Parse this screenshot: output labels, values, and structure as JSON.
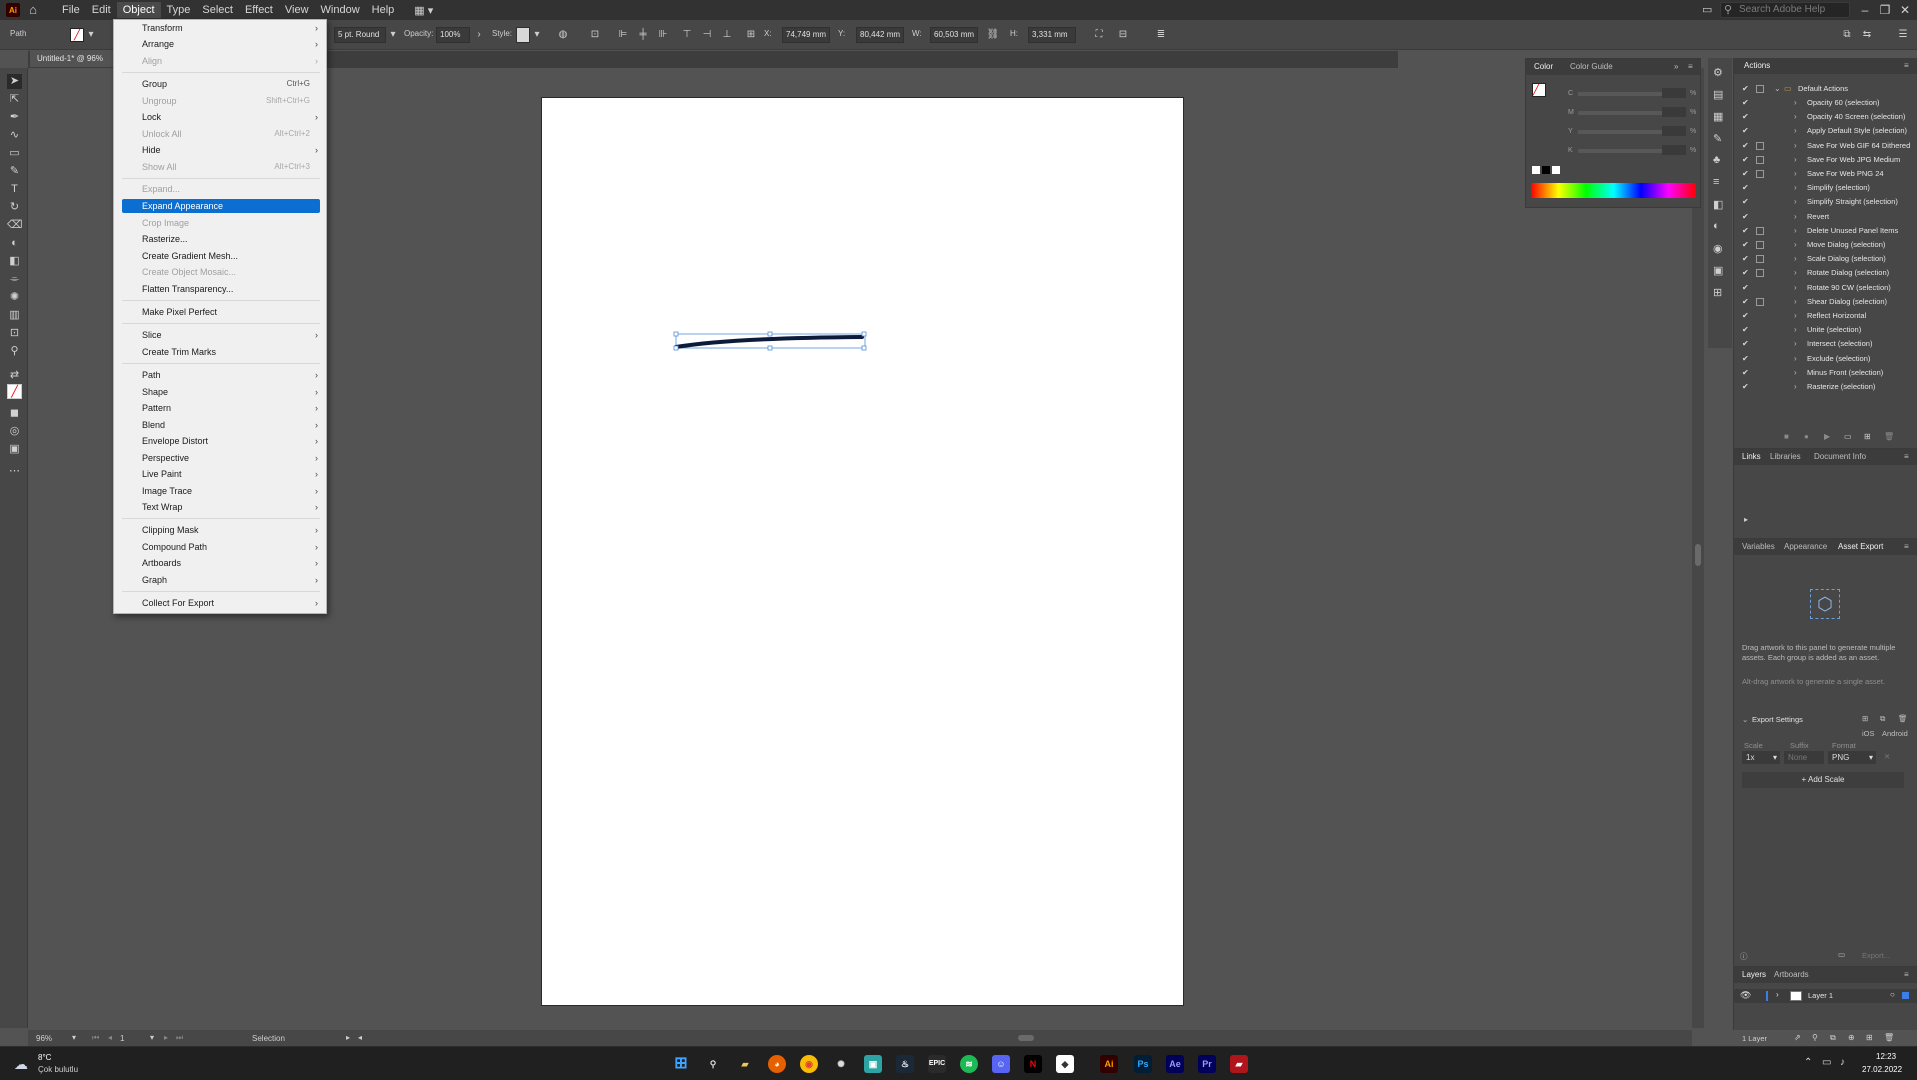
{
  "menubar": {
    "items": [
      "File",
      "Edit",
      "Object",
      "Type",
      "Select",
      "Effect",
      "View",
      "Window",
      "Help"
    ],
    "active": "Object",
    "app_logo": "Ai",
    "search_placeholder": "Search Adobe Help"
  },
  "control_bar": {
    "selection_type": "Path",
    "stroke_profile": "5 pt. Round",
    "opacity_label": "Opacity:",
    "opacity_value": "100%",
    "style_label": "Style:",
    "x_label": "X:",
    "x_value": "74,749 mm",
    "y_label": "Y:",
    "y_value": "80,442 mm",
    "w_label": "W:",
    "w_value": "60,503 mm",
    "h_label": "H:",
    "h_value": "3,331 mm"
  },
  "document": {
    "tab_title": "Untitled-1* @ 96%"
  },
  "object_menu": {
    "items": [
      {
        "label": "Transform",
        "shortcut": "",
        "submenu": true,
        "disabled": false,
        "selected": false
      },
      {
        "label": "Arrange",
        "shortcut": "",
        "submenu": true,
        "disabled": false,
        "selected": false
      },
      {
        "label": "Align",
        "shortcut": "",
        "submenu": true,
        "disabled": true,
        "selected": false
      },
      {
        "label": "Group",
        "shortcut": "Ctrl+G",
        "submenu": false,
        "disabled": false,
        "selected": false
      },
      {
        "label": "Ungroup",
        "shortcut": "Shift+Ctrl+G",
        "submenu": false,
        "disabled": true,
        "selected": false
      },
      {
        "label": "Lock",
        "shortcut": "",
        "submenu": true,
        "disabled": false,
        "selected": false
      },
      {
        "label": "Unlock All",
        "shortcut": "Alt+Ctrl+2",
        "submenu": false,
        "disabled": true,
        "selected": false
      },
      {
        "label": "Hide",
        "shortcut": "",
        "submenu": true,
        "disabled": false,
        "selected": false
      },
      {
        "label": "Show All",
        "shortcut": "Alt+Ctrl+3",
        "submenu": false,
        "disabled": true,
        "selected": false
      },
      {
        "label": "Expand...",
        "shortcut": "",
        "submenu": false,
        "disabled": true,
        "selected": false
      },
      {
        "label": "Expand Appearance",
        "shortcut": "",
        "submenu": false,
        "disabled": false,
        "selected": true
      },
      {
        "label": "Crop Image",
        "shortcut": "",
        "submenu": false,
        "disabled": true,
        "selected": false
      },
      {
        "label": "Rasterize...",
        "shortcut": "",
        "submenu": false,
        "disabled": false,
        "selected": false
      },
      {
        "label": "Create Gradient Mesh...",
        "shortcut": "",
        "submenu": false,
        "disabled": false,
        "selected": false
      },
      {
        "label": "Create Object Mosaic...",
        "shortcut": "",
        "submenu": false,
        "disabled": true,
        "selected": false
      },
      {
        "label": "Flatten Transparency...",
        "shortcut": "",
        "submenu": false,
        "disabled": false,
        "selected": false
      },
      {
        "label": "Make Pixel Perfect",
        "shortcut": "",
        "submenu": false,
        "disabled": false,
        "selected": false
      },
      {
        "label": "Slice",
        "shortcut": "",
        "submenu": true,
        "disabled": false,
        "selected": false
      },
      {
        "label": "Create Trim Marks",
        "shortcut": "",
        "submenu": false,
        "disabled": false,
        "selected": false
      },
      {
        "label": "Path",
        "shortcut": "",
        "submenu": true,
        "disabled": false,
        "selected": false
      },
      {
        "label": "Shape",
        "shortcut": "",
        "submenu": true,
        "disabled": false,
        "selected": false
      },
      {
        "label": "Pattern",
        "shortcut": "",
        "submenu": true,
        "disabled": false,
        "selected": false
      },
      {
        "label": "Blend",
        "shortcut": "",
        "submenu": true,
        "disabled": false,
        "selected": false
      },
      {
        "label": "Envelope Distort",
        "shortcut": "",
        "submenu": true,
        "disabled": false,
        "selected": false
      },
      {
        "label": "Perspective",
        "shortcut": "",
        "submenu": true,
        "disabled": false,
        "selected": false
      },
      {
        "label": "Live Paint",
        "shortcut": "",
        "submenu": true,
        "disabled": false,
        "selected": false
      },
      {
        "label": "Image Trace",
        "shortcut": "",
        "submenu": true,
        "disabled": false,
        "selected": false
      },
      {
        "label": "Text Wrap",
        "shortcut": "",
        "submenu": true,
        "disabled": false,
        "selected": false
      },
      {
        "label": "Clipping Mask",
        "shortcut": "",
        "submenu": true,
        "disabled": false,
        "selected": false
      },
      {
        "label": "Compound Path",
        "shortcut": "",
        "submenu": true,
        "disabled": false,
        "selected": false
      },
      {
        "label": "Artboards",
        "shortcut": "",
        "submenu": true,
        "disabled": false,
        "selected": false
      },
      {
        "label": "Graph",
        "shortcut": "",
        "submenu": true,
        "disabled": false,
        "selected": false
      },
      {
        "label": "Collect For Export",
        "shortcut": "",
        "submenu": true,
        "disabled": false,
        "selected": false
      }
    ]
  },
  "color_panel": {
    "tabs": [
      "Color",
      "Color Guide"
    ],
    "channels": [
      "C",
      "M",
      "Y",
      "K"
    ],
    "unit": "%"
  },
  "actions_panel": {
    "tab": "Actions",
    "set_name": "Default Actions",
    "actions": [
      {
        "label": "Opacity 60 (selection)",
        "dialog": false
      },
      {
        "label": "Opacity 40 Screen (selection)",
        "dialog": false
      },
      {
        "label": "Apply Default Style (selection)",
        "dialog": false
      },
      {
        "label": "Save For Web GIF 64 Dithered",
        "dialog": true
      },
      {
        "label": "Save For Web JPG Medium",
        "dialog": true
      },
      {
        "label": "Save For Web PNG 24",
        "dialog": true
      },
      {
        "label": "Simplify (selection)",
        "dialog": false
      },
      {
        "label": "Simplify Straight (selection)",
        "dialog": false
      },
      {
        "label": "Revert",
        "dialog": false
      },
      {
        "label": "Delete Unused Panel Items",
        "dialog": true
      },
      {
        "label": "Move Dialog (selection)",
        "dialog": true
      },
      {
        "label": "Scale Dialog (selection)",
        "dialog": true
      },
      {
        "label": "Rotate Dialog (selection)",
        "dialog": true
      },
      {
        "label": "Rotate 90 CW (selection)",
        "dialog": false
      },
      {
        "label": "Shear Dialog (selection)",
        "dialog": true
      },
      {
        "label": "Reflect Horizontal",
        "dialog": false
      },
      {
        "label": "Unite (selection)",
        "dialog": false
      },
      {
        "label": "Intersect (selection)",
        "dialog": false
      },
      {
        "label": "Exclude (selection)",
        "dialog": false
      },
      {
        "label": "Minus Front (selection)",
        "dialog": false
      },
      {
        "label": "Rasterize (selection)",
        "dialog": false
      }
    ]
  },
  "links_panel": {
    "tabs": [
      "Links",
      "Libraries",
      "Document Info"
    ]
  },
  "asset_export_panel": {
    "tabs": [
      "Variables",
      "Appearance",
      "Asset Export"
    ],
    "hint_1": "Drag artwork to this panel to generate multiple assets. Each group is added as an asset.",
    "hint_2": "Alt-drag artwork to generate a single asset.",
    "export_settings_label": "Export Settings",
    "ios_label": "iOS",
    "android_label": "Android",
    "scale_header": "Scale",
    "suffix_header": "Suffix",
    "format_header": "Format",
    "scale_value": "1x",
    "suffix_placeholder": "None",
    "format_value": "PNG",
    "add_scale_label": "+ Add Scale",
    "export_button": "Export..."
  },
  "layers_panel": {
    "tabs": [
      "Layers",
      "Artboards"
    ],
    "layer_name": "Layer 1",
    "count_label": "1 Layer"
  },
  "status_bar": {
    "zoom": "96%",
    "page": "1",
    "mode": "Selection"
  },
  "taskbar": {
    "weather_temp": "8°C",
    "weather_desc": "Çok bulutlu",
    "time": "12:23",
    "date": "27.02.2022"
  },
  "colors": {
    "menu_highlight": "#0b6ed1",
    "ui_dark": "#323232",
    "ui_mid": "#474747",
    "canvas_bg": "#535353",
    "path_stroke": "#0d1a3a",
    "selection": "#4f8fd8"
  }
}
